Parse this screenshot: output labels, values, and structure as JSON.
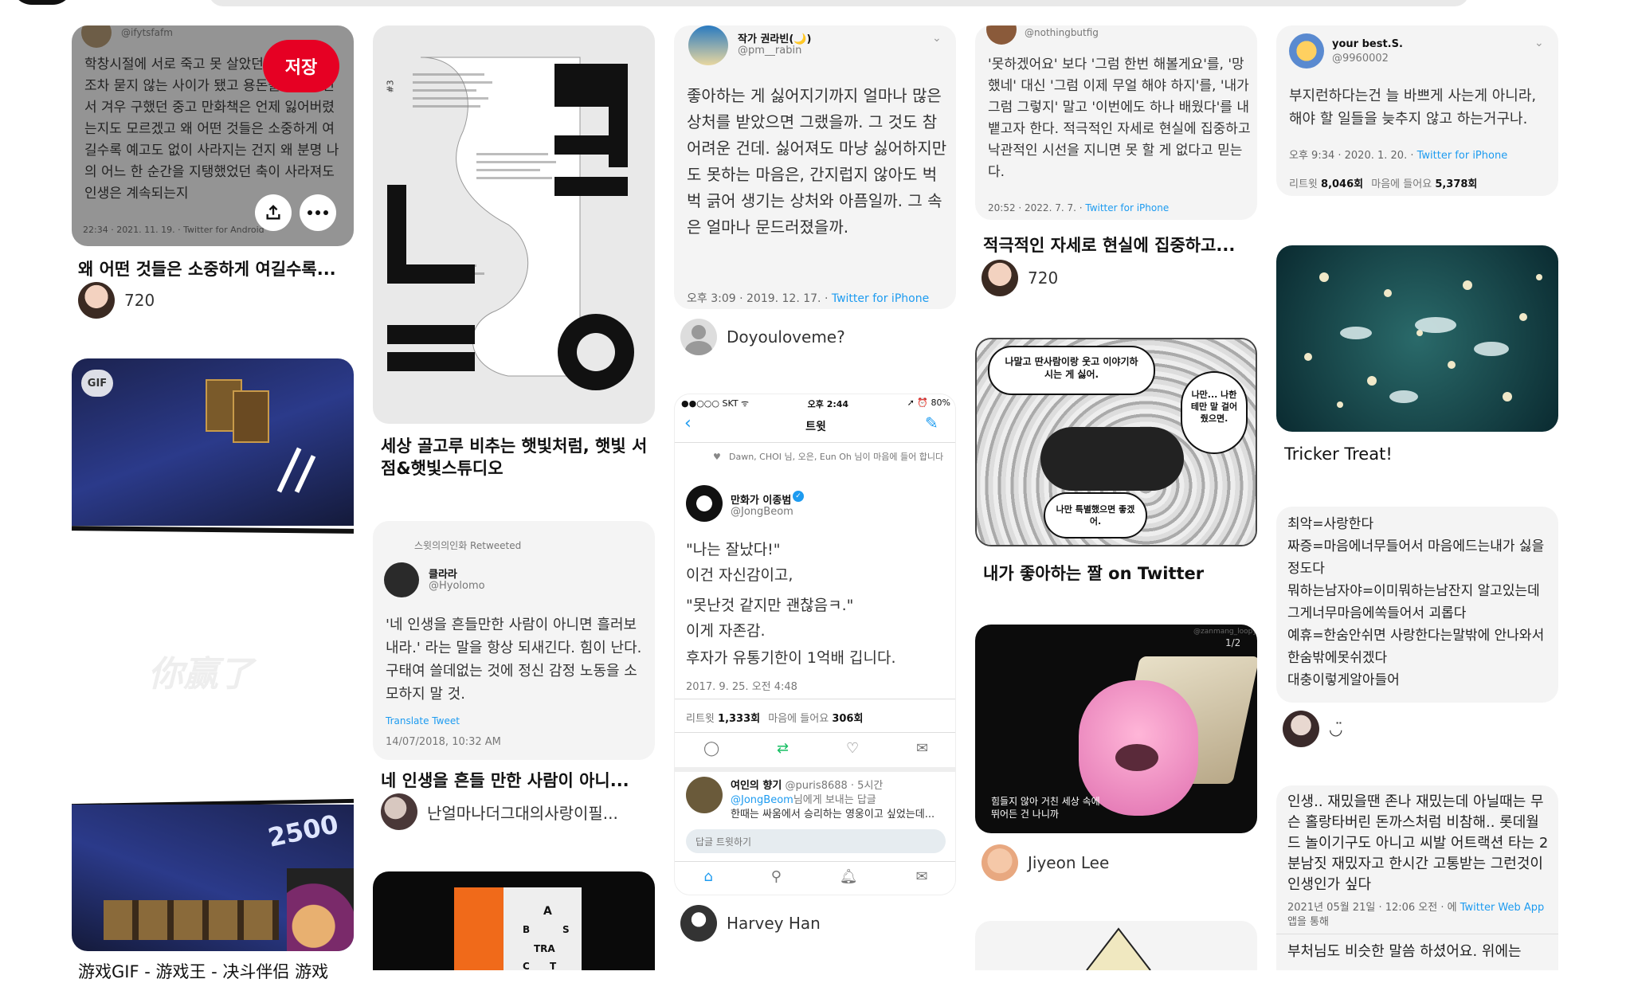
{
  "top": {
    "logo": "",
    "search": ""
  },
  "col1": {
    "pin1": {
      "handle": "@ifytsfafm",
      "text": "학창시절에 서로 죽고 못 살았던 친구는 안부조차 묻지 않는 사이가 됐고 용돈을 모아가면서 겨우 구했던 중고 만화책은 언제 잃어버렸는지도 모르겠고 왜 어떤 것들은 소중하게 여길수록 예고도 없이 사라지는 건지 왜 분명 나의 어느 한 순간을 지탱했었던 축이 사라져도 인생은 계속되는지",
      "meta": "22:34 · 2021. 11. 19. · Twitter for Android",
      "save": "저장",
      "title": "왜 어떤 것들은 소중하게 여길수록...",
      "author": "720"
    },
    "pin2": {
      "badge": "GIF",
      "score": "2500",
      "wm": "你赢了",
      "title": "游戏GIF - 游戏王 - 决斗伴侣 游戏"
    }
  },
  "col2": {
    "pin1": {
      "poster": "PI LOT",
      "num": "#3",
      "title": "세상 골고루 비추는 햇빛처럼, 햇빛 서점&햇빛스튜디오"
    },
    "pin2": {
      "rt": "스윗의의인화 Retweeted",
      "name": "클라라",
      "handle": "@Hyolomo",
      "text": "'네 인생을 흔들만한 사람이 아니면 흘러보내라.' 라는 말을 항상 되새긴다. 힘이 난다. 구태여 쓸데없는 것에 정신 감정 노동을 소모하지 말 것.",
      "translate": "Translate Tweet",
      "date": "14/07/2018, 10:32 AM",
      "title": "네 인생을 흔들 만한 사람이 아니...",
      "author": "난얼마나더그대의사랑이필..."
    },
    "pin3": {
      "letters": [
        "A",
        "B",
        "S",
        "TRA",
        "C",
        "T"
      ]
    }
  },
  "col3": {
    "pin1": {
      "name": "작가 권라빈(🌙)",
      "handle": "@pm__rabin",
      "text": "좋아하는 게 싫어지기까지 얼마나 많은 상처를 받았으면 그랬을까. 그 것도 참 어려운 건데. 싫어져도 마냥 싫어하지만도 못하는 마음은, 간지럽지 않아도 벅벅 긁어 생기는 상처와 아픔일까. 그 속은 얼마나 문드러졌을까.",
      "meta_time": "오후 3:09 · 2019. 12. 17. · ",
      "meta_app": "Twitter for iPhone",
      "author": "Doyouloveme?"
    },
    "pin2": {
      "status_left": "●●○○○ SKT ᯤ",
      "status_time": "오후 2:44",
      "status_right": "➚ ⏰ 80%",
      "nav_title": "트윗",
      "liked": "Dawn, CHOI 님, 오은, Eun Oh 님이 마음에 들어 합니다",
      "name": "만화가 이종범",
      "handle": "@JongBeom",
      "line1": "\"나는 잘났다!\"",
      "line2": "이건 자신감이고,",
      "line3": "\"못난것 같지만 괜찮음ㅋ.\"",
      "line4": "이게 자존감.",
      "line5": "후자가 유통기한이 1억배 깁니다.",
      "date": "2017. 9. 25. 오전 4:48",
      "rt_label": "리트윗",
      "rt": "1,333회",
      "like_label": "마음에 들어요",
      "likes": "306회",
      "reply_name": "여인의 향기",
      "reply_handle": "@puris8688 · 5시간",
      "reply_to": "@JongBeom",
      "reply_to_tail": "님에게 보내는 답글",
      "reply_text": "한때는 싸움에서 승리하는 영웅이고 싶었는데...",
      "reply_box": "답글 트윗하기",
      "author": "Harvey Han"
    }
  },
  "col4": {
    "pin1": {
      "handle": "@nothingbutfig",
      "text": "'못하겠어요' 보다 '그럼 한번 해볼게요'를, '망했네' 대신 '그럼 이제 무얼 해야 하지'를, '내가 그럼 그렇지' 말고 '이번에도 하나 배웠다'를 내뱉고자 한다. 적극적인 자세로 현실에 집중하고 낙관적인 시선을 지니면 못 할 게 없다고 믿는다.",
      "meta": "20:52 · 2022. 7. 7. · ",
      "meta_app": "Twitter for iPhone",
      "title": "적극적인 자세로 현실에 집중하고...",
      "author": "720"
    },
    "pin2": {
      "b1": "나말고 딴사람이랑 웃고 이야기하시는 게 싫어.",
      "b2": "나만... 나한테만 말 걸어 줬으면.",
      "b3": "나만 특별했으면 좋겠어.",
      "title": "내가 좋아하는 짤 on Twitter"
    },
    "pin3": {
      "counter": "1/2",
      "wm": "@zanmang_loopy",
      "caption": "힘들지 않아 거친 세상 속에 뛰어든 건 나니까",
      "author": "Jiyeon Lee"
    }
  },
  "col5": {
    "pin1": {
      "name": "your best.S.",
      "handle": "@9960002",
      "text": "부지런하다는건 늘 바쁘게 사는게 아니라, 해야 할 일들을 늦추지 않고 하는거구나.",
      "meta": "오후 9:34 · 2020. 1. 20. · ",
      "meta_app": "Twitter for iPhone",
      "rt_label": "리트윗",
      "rt": "8,046회",
      "like_label": "마음에 들어요",
      "likes": "5,378회"
    },
    "pin2": {
      "title": "Tricker Treat!"
    },
    "pin3": {
      "text": "최악=사랑한다\n짜증=마음에너무들어서 마음에드는내가 싫을정도다\n뭐하는남자야=이미뭐하는남잔지 알고있는데 그게너무마음에쏙들어서 괴롭다\n예휴=한숨안쉬면 사랑한다는말밖에 안나와서 한숨밖에못쉬겠다\n대충이렇게알아들어",
      "author": "◡̈"
    },
    "pin4": {
      "text": "인생.. 재밌을땐 존나 재밌는데 아닐때는 무슨 홀랑타버린 돈까스처럼 비참해.. 롯데월드 놀이기구도 아니고 씨발 어트랙션 타는 2분남짓 재밌자고 한시간 고통받는 그런것이 인생인가 싶다",
      "meta": "2021년 05월 21일 · 12:06 오전 · 에 ",
      "meta_app": "Twitter Web App",
      "meta2": "앱을 통해",
      "text2": "부처님도 비슷한 말씀 하셨어요. 위에는"
    }
  }
}
